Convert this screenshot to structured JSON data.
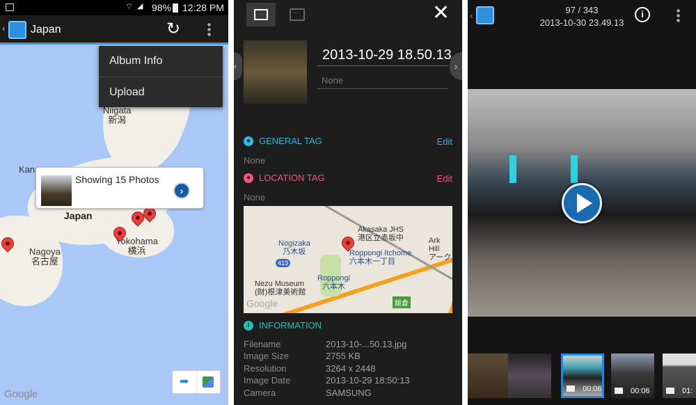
{
  "left": {
    "status": {
      "battery": "98%",
      "time": "12:28 PM"
    },
    "title": "Japan",
    "menu": [
      "Album Info",
      "Upload"
    ],
    "bubble": {
      "text": "Showing 15 Photos"
    },
    "map_labels": {
      "niigata": "Niigata",
      "niigata_jp": "新潟",
      "japan": "Japan",
      "nagoya": "Nagoya",
      "nagoya_jp": "名古屋",
      "yokohama": "Yokohama",
      "yokohama_jp": "横浜",
      "kana": "Kana",
      "google": "Google"
    }
  },
  "middle": {
    "title": "2013-10-29 18.50.13",
    "description_placeholder": "None",
    "general_tag": {
      "label": "GENERAL TAG",
      "edit": "Edit",
      "value": "None"
    },
    "location_tag": {
      "label": "LOCATION TAG",
      "edit": "Edit",
      "value": "None"
    },
    "map_labels": {
      "akasaka": "Akasaka JHS",
      "akasaka_jp": "港区立赤坂中",
      "nogizaka": "Nogizaka",
      "nogizaka_jp": "乃木坂",
      "roppongi1": "Roppongi Itchome",
      "roppongi1_jp": "六本木一丁目",
      "ark": "Ark Hill",
      "ark_jp": "アーク",
      "roppongi": "Roppongi",
      "roppongi_jp": "六本木",
      "nezu": "Nezu Museum",
      "nezu_jp": "(財)根津美術館",
      "route": "413",
      "iikura": "飯倉",
      "google": "Google"
    },
    "information": {
      "label": "INFORMATION",
      "rows": [
        {
          "label": "Filename",
          "value": "2013-10-...50.13.jpg"
        },
        {
          "label": "Image Size",
          "value": "2755 KB"
        },
        {
          "label": "Resolution",
          "value": "3264 x 2448"
        },
        {
          "label": "Image Date",
          "value": "2013-10-29 18:50:13"
        },
        {
          "label": "Camera",
          "value": "SAMSUNG"
        }
      ]
    },
    "colors": {
      "general": "#33b5e5",
      "location": "#f2557e",
      "information": "#1fc4b4"
    }
  },
  "right": {
    "counter": "97 / 343",
    "date": "2013-10-30 23.49.13",
    "thumbs": [
      {
        "duration": ""
      },
      {
        "duration": ""
      },
      {
        "duration": "00:06"
      },
      {
        "duration": "00:06"
      },
      {
        "duration": "01:"
      }
    ]
  }
}
